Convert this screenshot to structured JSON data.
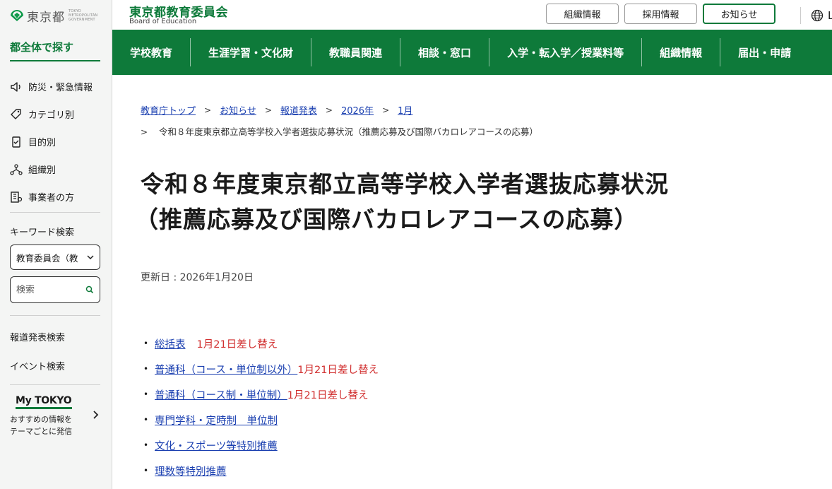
{
  "sidebar": {
    "logo_text": "東京都",
    "logo_sub": "TOKYO METROPOLITAN GOVERNMENT",
    "find_all": "都全体で探す",
    "nav": [
      {
        "label": "防災・緊急情報",
        "icon": "megaphone-icon"
      },
      {
        "label": "カテゴリ別",
        "icon": "tag-icon"
      },
      {
        "label": "目的別",
        "icon": "document-icon"
      },
      {
        "label": "組織別",
        "icon": "org-chart-icon"
      },
      {
        "label": "事業者の方",
        "icon": "building-icon"
      }
    ],
    "keyword_label": "キーワード検索",
    "scope_value": "教育委員会（教",
    "search_placeholder": "検索",
    "press_search": "報道発表検索",
    "event_search": "イベント検索",
    "mytokyo_logo": "My TOKYO",
    "mytokyo_desc_1": "おすすめの情報を",
    "mytokyo_desc_2": "テーマごとに発信"
  },
  "header": {
    "org_name": "東京都教育委員会",
    "org_sub": "Board of Education",
    "buttons": [
      "組織情報",
      "採用情報",
      "お知らせ"
    ],
    "language": "La"
  },
  "gnav": [
    "学校教育",
    "生涯学習・文化財",
    "教職員関連",
    "相談・窓口",
    "入学・転入学／授業料等",
    "組織情報",
    "届出・申請"
  ],
  "breadcrumb": {
    "items": [
      "教育庁トップ",
      "お知らせ",
      "報道発表",
      "2026年",
      "1月"
    ],
    "current": "令和８年度東京都立高等学校入学者選抜応募状況（推薦応募及び国際バカロレアコースの応募）"
  },
  "page": {
    "title_line1": "令和８年度東京都立高等学校入学者選抜応募状況",
    "title_line2": "（推薦応募及び国際バカロレアコースの応募）",
    "updated": "更新日 : 2026年1月20日"
  },
  "documents": [
    {
      "label": "総括表",
      "note": "1月21日差し替え"
    },
    {
      "label": "普通科（コース・単位制以外）",
      "note": "1月21日差し替え"
    },
    {
      "label": "普通科（コース制・単位制）",
      "note": "1月21日差し替え"
    },
    {
      "label": "専門学科・定時制　単位制",
      "note": ""
    },
    {
      "label": "文化・スポーツ等特別推薦",
      "note": ""
    },
    {
      "label": "理数等特別推薦",
      "note": ""
    }
  ],
  "colors": {
    "brand_green": "#0e7a3a",
    "link_blue": "#1a3fb0",
    "note_red": "#d12f2f"
  }
}
